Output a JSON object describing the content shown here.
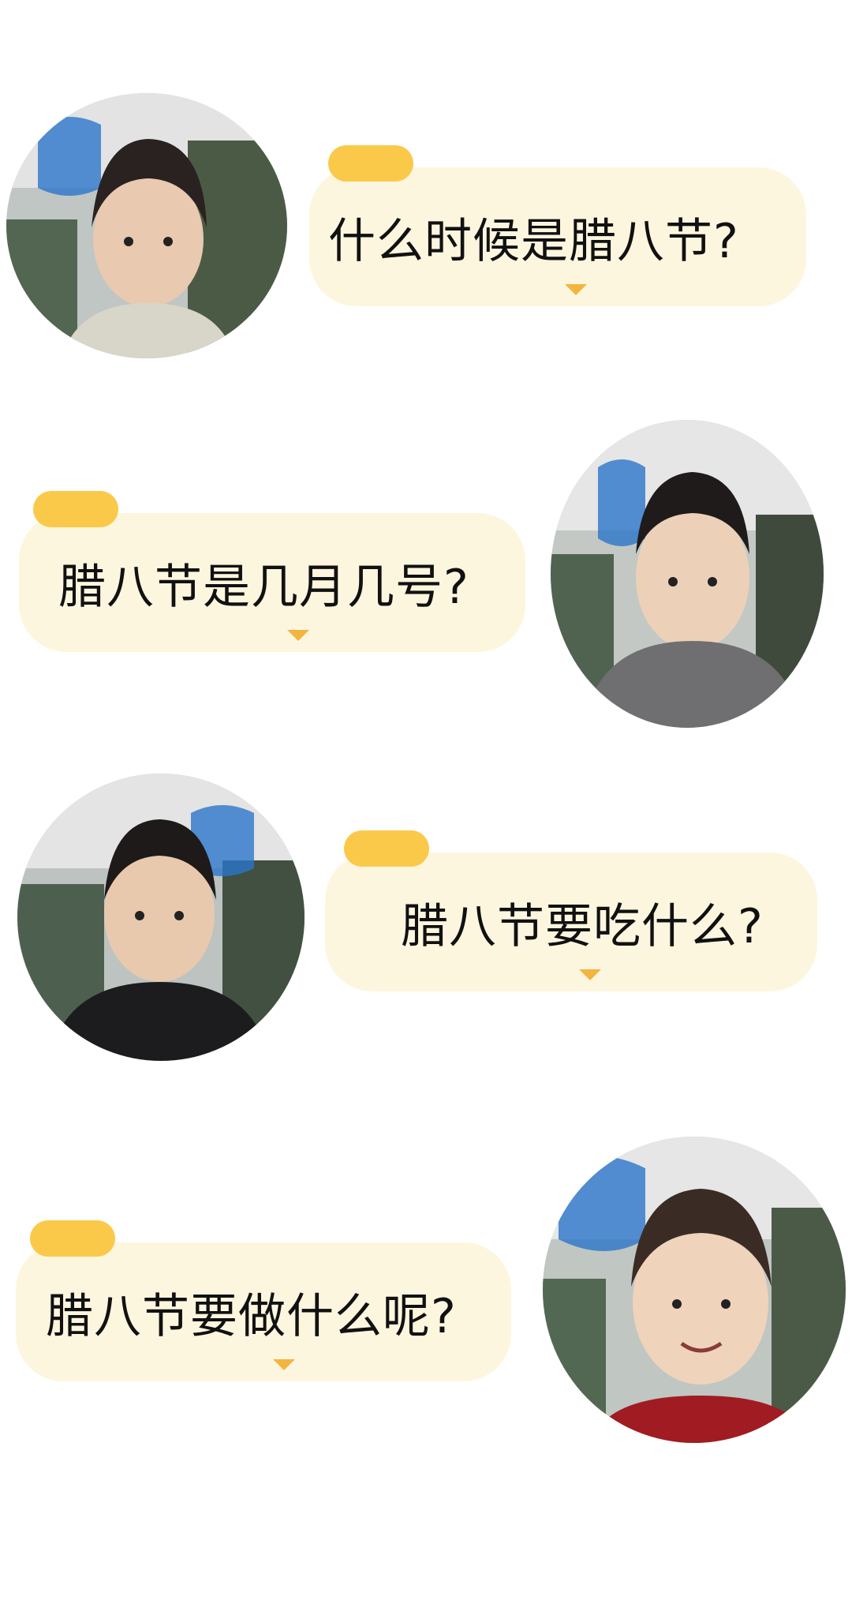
{
  "dialogs": [
    {
      "question": "什么时候是腊八节?",
      "avatar": "avatar-girl"
    },
    {
      "question": "腊八节是几月几号?",
      "avatar": "avatar-boy-gray-jacket"
    },
    {
      "question": "腊八节要吃什么?",
      "avatar": "avatar-boy-black-jacket"
    },
    {
      "question": "腊八节要做什么呢?",
      "avatar": "avatar-boy-smiling"
    }
  ],
  "colors": {
    "bubble": "#fdf6df",
    "pill": "#fbc94a",
    "marker": "#f3b53f",
    "text": "#111111"
  }
}
